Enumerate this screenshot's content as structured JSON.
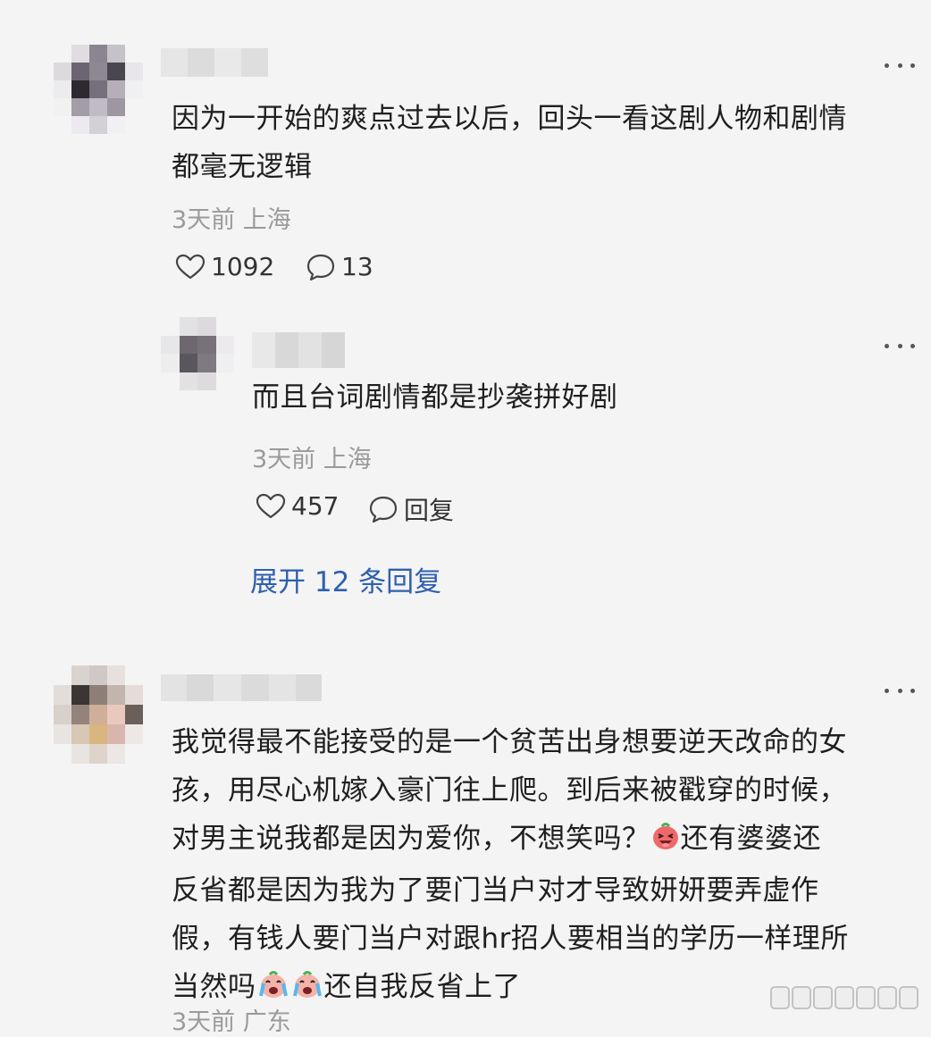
{
  "comments": [
    {
      "text_lines": [
        "因为一开始的爽点过去以后，回头一看这剧人物和剧情",
        "都毫无逻辑"
      ],
      "meta": "3天前 上海",
      "likes": "1092",
      "replies": "13",
      "reply": {
        "text": "而且台词剧情都是抄袭拼好剧",
        "meta": "3天前 上海",
        "likes": "457",
        "reply_label": "回复"
      },
      "expand_label": "展开 12 条回复"
    },
    {
      "text_lines": [
        "我觉得最不能接受的是一个贫苦出身想要逆天改命的女",
        "孩，用尽心机嫁入豪门往上爬。到后来被戳穿的时候，",
        "对男主说我都是因为爱你，不想笑吗？",
        "还有婆婆还",
        "反省都是因为我为了要门当户对才导致妍妍要弄虚作",
        "假，有钱人要门当户对跟hr招人要相当的学历一样理所",
        "当然吗",
        "还自我反省上了"
      ],
      "meta": "3天前 广东"
    }
  ],
  "icons": {
    "more": "more-dots-icon",
    "like": "heart-outline-icon",
    "comment": "comment-bubble-icon",
    "emoji_laugh": "laughing-emoji-icon",
    "emoji_cry": "crying-emoji-icon"
  },
  "colors": {
    "link": "#2f5fae",
    "meta": "#9a9a9a",
    "background": "#f4f4f4"
  }
}
